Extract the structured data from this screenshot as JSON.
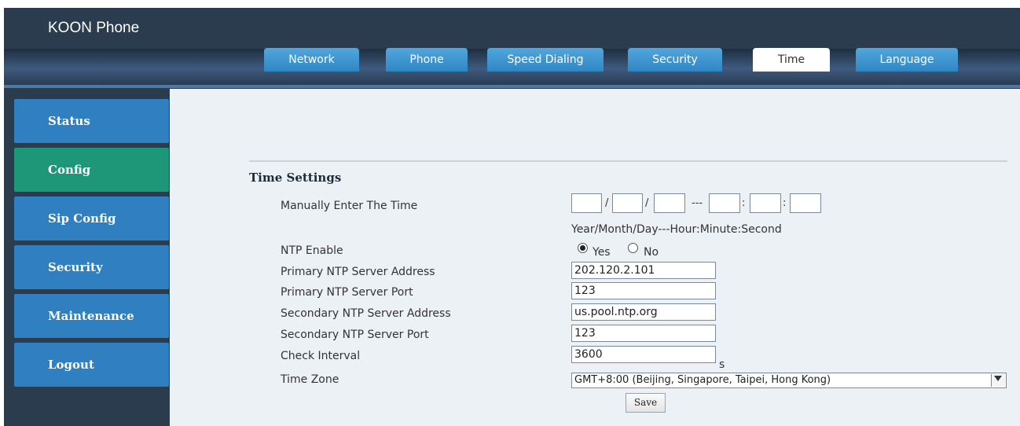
{
  "app": {
    "title": "KOON Phone"
  },
  "tabs": [
    {
      "label": "Network"
    },
    {
      "label": "Phone"
    },
    {
      "label": "Speed Dialing"
    },
    {
      "label": "Security"
    },
    {
      "label": "Time"
    },
    {
      "label": "Language"
    }
  ],
  "active_tab": "Time",
  "sidebar": {
    "items": [
      {
        "label": "Status"
      },
      {
        "label": "Config"
      },
      {
        "label": "Sip Config"
      },
      {
        "label": "Security"
      },
      {
        "label": "Maintenance"
      },
      {
        "label": "Logout"
      }
    ],
    "active": "Config"
  },
  "time_settings": {
    "title": "Time Settings",
    "manual": {
      "label": "Manually Enter The Time",
      "separators": [
        "/",
        "/",
        "---",
        ":",
        ":"
      ],
      "hint": "Year/Month/Day---Hour:Minute:Second",
      "values": [
        "",
        "",
        "",
        "",
        "",
        ""
      ]
    },
    "ntp_enable": {
      "label": "NTP Enable",
      "yes_label": "Yes",
      "no_label": "No",
      "selected": "Yes"
    },
    "primary_addr": {
      "label": "Primary NTP Server Address",
      "value": "202.120.2.101"
    },
    "primary_port": {
      "label": "Primary NTP Server Port",
      "value": "123"
    },
    "secondary_addr": {
      "label": "Secondary NTP Server Address",
      "value": "us.pool.ntp.org"
    },
    "secondary_port": {
      "label": "Secondary NTP Server Port",
      "value": "123"
    },
    "check_interval": {
      "label": "Check Interval",
      "value": "3600",
      "unit": "s"
    },
    "time_zone": {
      "label": "Time Zone",
      "value": "GMT+8:00 (Beijing, Singapore, Taipei, Hong Kong)"
    },
    "save_label": "Save"
  },
  "colors": {
    "header_bg": "#2b3c4f",
    "tab_blue": "#2f86c4",
    "nav_blue": "#2f7fc1",
    "nav_active_green": "#1d9778",
    "content_bg": "#ecf1f6"
  }
}
